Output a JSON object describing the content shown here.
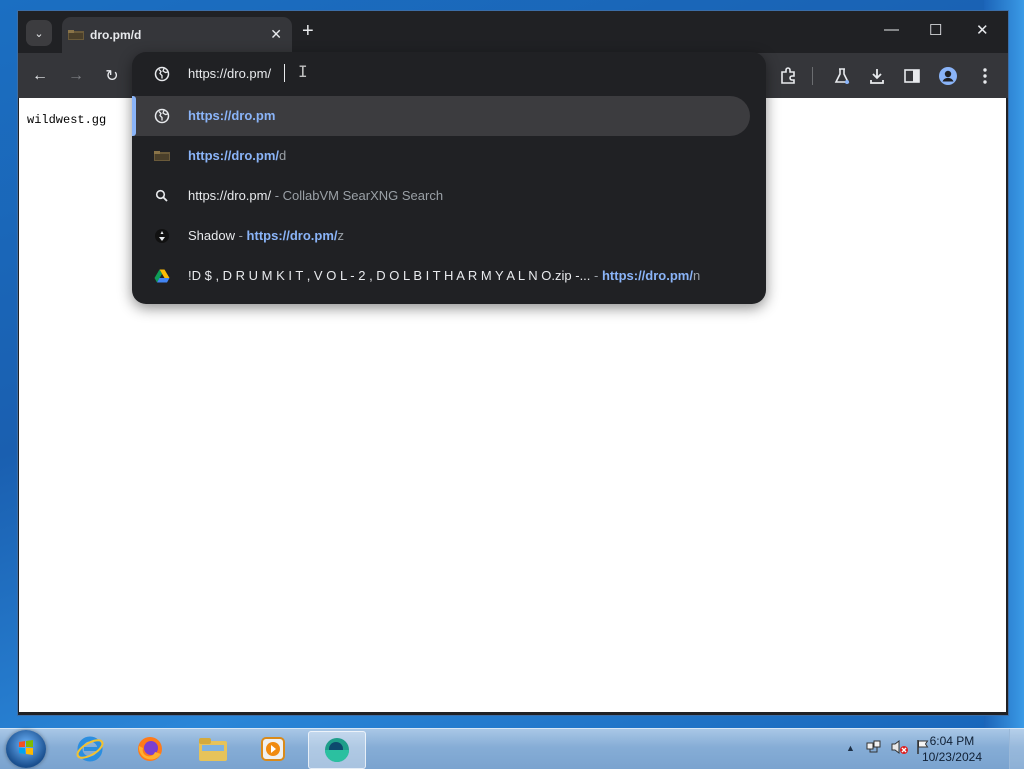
{
  "browser": {
    "tab": {
      "title": "dro.pm/d",
      "close_glyph": "✕"
    },
    "new_tab_glyph": "+",
    "tab_search_glyph": "⌄",
    "window_controls": {
      "minimize": "—",
      "maximize": "☐",
      "close": "✕"
    },
    "toolbar": {
      "back": "←",
      "forward": "→",
      "reload": "↻"
    }
  },
  "omnibox": {
    "input_value": "https://dro.pm/",
    "suggestions": [
      {
        "icon": "globe-icon",
        "primary": "https://dro.pm",
        "secondary": ""
      },
      {
        "icon": "folder-favicon-icon",
        "primary_bold": "https://dro.pm/",
        "primary_rest": "d"
      },
      {
        "icon": "search-icon",
        "primary": "https://dro.pm/",
        "sep": " - ",
        "secondary": "CollabVM SearXNG Search"
      },
      {
        "icon": "shadow-favicon-icon",
        "primary": "Shadow",
        "sep": " - ",
        "url_bold": "https://dro.pm/",
        "url_rest": "z"
      },
      {
        "icon": "google-drive-icon",
        "primary": "!D $ , D R U M K I T , V O L - 2 , D O L B I T H A R M Y A L N O.zip -...",
        "sep": "  - ",
        "url_bold": "https://dro.pm/",
        "url_rest": "n"
      }
    ]
  },
  "page": {
    "text": "wildwest.gg"
  },
  "taskbar": {
    "clock_time": "6:04 PM",
    "clock_date": "10/23/2024",
    "tray_up_glyph": "▲"
  },
  "colors": {
    "accent_blue": "#8ab4f8",
    "chrome_dark": "#202124",
    "toolbar": "#35363a"
  }
}
